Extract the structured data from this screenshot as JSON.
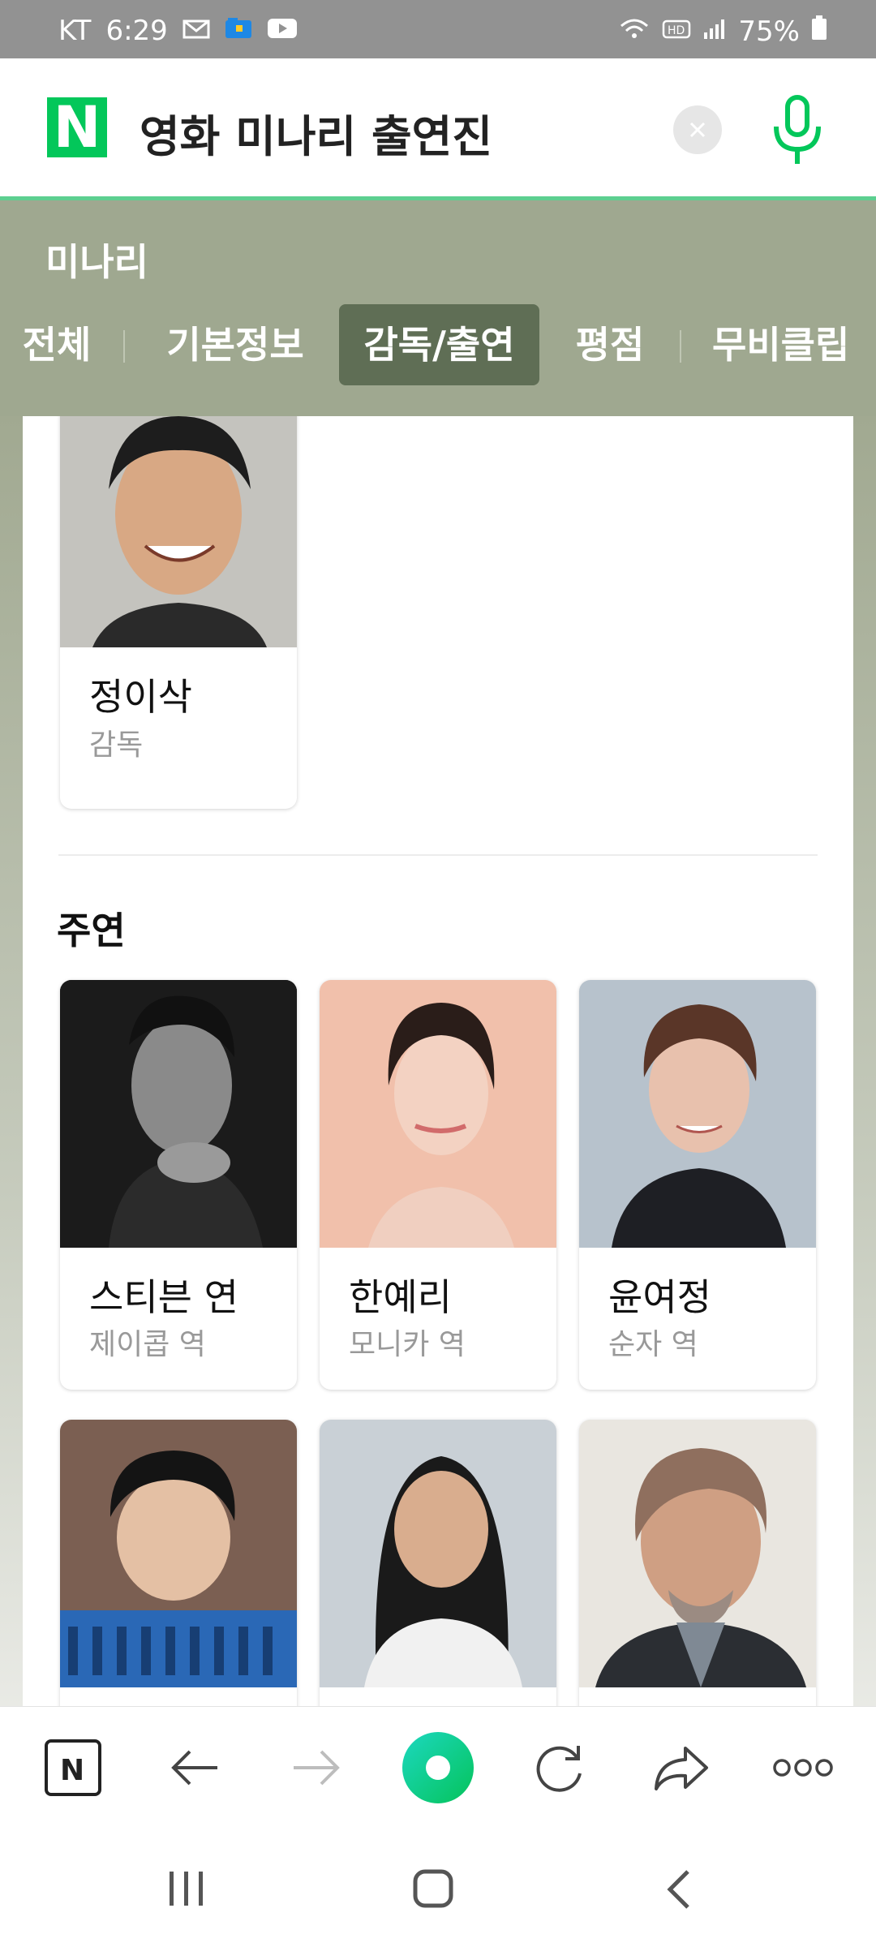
{
  "status_bar": {
    "carrier": "KT",
    "time": "6:29",
    "battery": "75%"
  },
  "search": {
    "query": "영화 미나리 출연진"
  },
  "movie": {
    "title": "미나리",
    "tabs": [
      {
        "label": "전체"
      },
      {
        "label": "기본정보"
      },
      {
        "label": "감독/출연",
        "active": true
      },
      {
        "label": "평점"
      },
      {
        "label": "무비클립"
      }
    ]
  },
  "director": {
    "name": "정이삭",
    "role": "감독"
  },
  "cast_section": {
    "title": "주연",
    "cards": [
      {
        "name": "스티븐 연",
        "role": "제이콥 역"
      },
      {
        "name": "한예리",
        "role": "모니카 역"
      },
      {
        "name": "윤여정",
        "role": "순자 역"
      },
      {
        "name": "",
        "role": ""
      },
      {
        "name": "",
        "role": ""
      },
      {
        "name": "",
        "role": ""
      }
    ]
  },
  "toolbar": {
    "buttons": [
      "naver-home-icon",
      "back-arrow-icon",
      "forward-arrow-icon",
      "green-dot-icon",
      "refresh-icon",
      "share-icon",
      "more-icon"
    ]
  },
  "colors": {
    "accent": "#03c75a",
    "header": "#9fa890",
    "active_tab": "#5f6e55"
  }
}
